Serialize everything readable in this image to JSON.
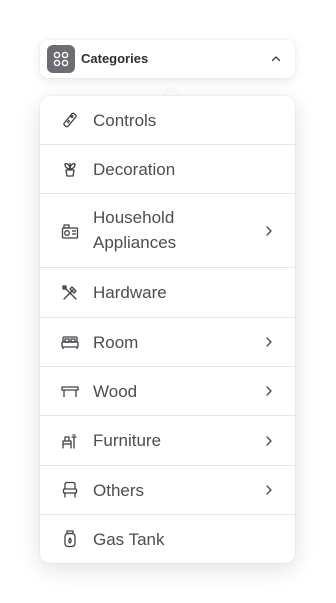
{
  "trigger": {
    "label": "Categories",
    "icon": "category-grid-icon",
    "chevron": "chevron-up-icon"
  },
  "menu": {
    "items": [
      {
        "label": "Controls",
        "icon": "remote-control-icon",
        "has_submenu": false
      },
      {
        "label": "Decoration",
        "icon": "plant-pot-icon",
        "has_submenu": false
      },
      {
        "label": "Household",
        "label2": "Appliances",
        "icon": "appliance-icon",
        "has_submenu": true
      },
      {
        "label": "Hardware",
        "icon": "tools-icon",
        "has_submenu": false
      },
      {
        "label": "Room",
        "icon": "bed-icon",
        "has_submenu": true
      },
      {
        "label": "Wood",
        "icon": "table-icon",
        "has_submenu": true
      },
      {
        "label": "Furniture",
        "icon": "furniture-icon",
        "has_submenu": true
      },
      {
        "label": "Others",
        "icon": "chair-icon",
        "has_submenu": true
      },
      {
        "label": "Gas Tank",
        "icon": "gas-tank-icon",
        "has_submenu": false
      }
    ]
  },
  "colors": {
    "text": "#4b4d52",
    "icon": "#3f4146",
    "badge": "#6b6d72",
    "divider": "#e6e6e8"
  }
}
